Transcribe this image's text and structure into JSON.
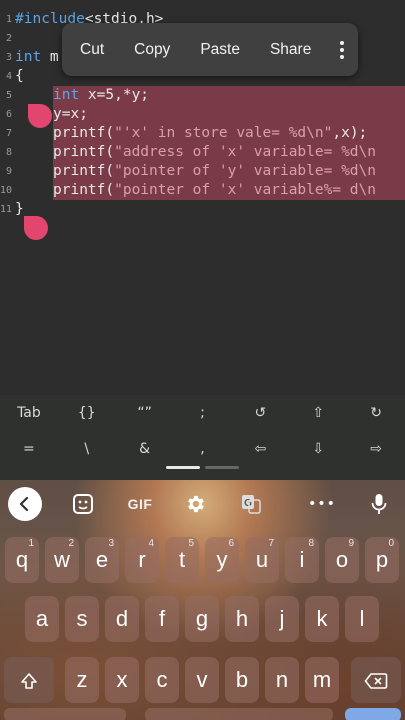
{
  "editor": {
    "lines": [
      {
        "num": "1",
        "parts": [
          {
            "t": "#include",
            "c": "pre"
          },
          {
            "t": "<stdio.h>",
            "c": ""
          }
        ]
      },
      {
        "num": "2",
        "parts": []
      },
      {
        "num": "3",
        "parts": [
          {
            "t": "int",
            "c": "kw"
          },
          {
            "t": " m",
            "c": ""
          }
        ]
      },
      {
        "num": "4",
        "parts": [
          {
            "t": "{",
            "c": ""
          }
        ]
      },
      {
        "num": "5",
        "parts": [
          {
            "t": "int",
            "c": "kw"
          },
          {
            "t": " x=5,*y;",
            "c": ""
          }
        ]
      },
      {
        "num": "6",
        "parts": [
          {
            "t": "y=x;",
            "c": ""
          }
        ]
      },
      {
        "num": "7",
        "parts": [
          {
            "t": "printf(",
            "c": ""
          },
          {
            "t": "\"'x' in store vale= %d\\n\"",
            "c": "str"
          },
          {
            "t": ",x);",
            "c": ""
          }
        ]
      },
      {
        "num": "8",
        "parts": [
          {
            "t": "printf(",
            "c": ""
          },
          {
            "t": "\"address of 'x' variable= %d\\n",
            "c": "str"
          }
        ]
      },
      {
        "num": "9",
        "parts": [
          {
            "t": "printf(",
            "c": ""
          },
          {
            "t": "\"pointer of 'y' variable= %d\\n",
            "c": "str"
          }
        ]
      },
      {
        "num": "10",
        "parts": [
          {
            "t": "printf(",
            "c": ""
          },
          {
            "t": "\"pointer of 'x' variable%= d\\n",
            "c": "str"
          }
        ]
      },
      {
        "num": "11",
        "parts": [
          {
            "t": "}",
            "c": ""
          }
        ]
      }
    ]
  },
  "context_menu": {
    "items": [
      "Cut",
      "Copy",
      "Paste",
      "Share"
    ]
  },
  "extra_keys": {
    "row1": [
      "Tab",
      "{}",
      "“”",
      ";",
      "↺",
      "⇧",
      "↻"
    ],
    "row2": [
      "=",
      "\\",
      "&",
      ",",
      "⇦",
      "⇩",
      "⇨"
    ]
  },
  "keyboard": {
    "toolbar": {
      "gif": "GIF",
      "more": "•••"
    },
    "row1": [
      {
        "k": "q",
        "h": "1"
      },
      {
        "k": "w",
        "h": "2"
      },
      {
        "k": "e",
        "h": "3"
      },
      {
        "k": "r",
        "h": "4"
      },
      {
        "k": "t",
        "h": "5"
      },
      {
        "k": "y",
        "h": "6"
      },
      {
        "k": "u",
        "h": "7"
      },
      {
        "k": "i",
        "h": "8"
      },
      {
        "k": "o",
        "h": "9"
      },
      {
        "k": "p",
        "h": "0"
      }
    ],
    "row2": [
      "a",
      "s",
      "d",
      "f",
      "g",
      "h",
      "j",
      "k",
      "l"
    ],
    "row3": [
      "z",
      "x",
      "c",
      "v",
      "b",
      "n",
      "m"
    ]
  },
  "colors": {
    "selection": "#7a3a48",
    "handle": "#e2466f",
    "keyword": "#5aa6e8",
    "string": "#d9a0a8"
  }
}
